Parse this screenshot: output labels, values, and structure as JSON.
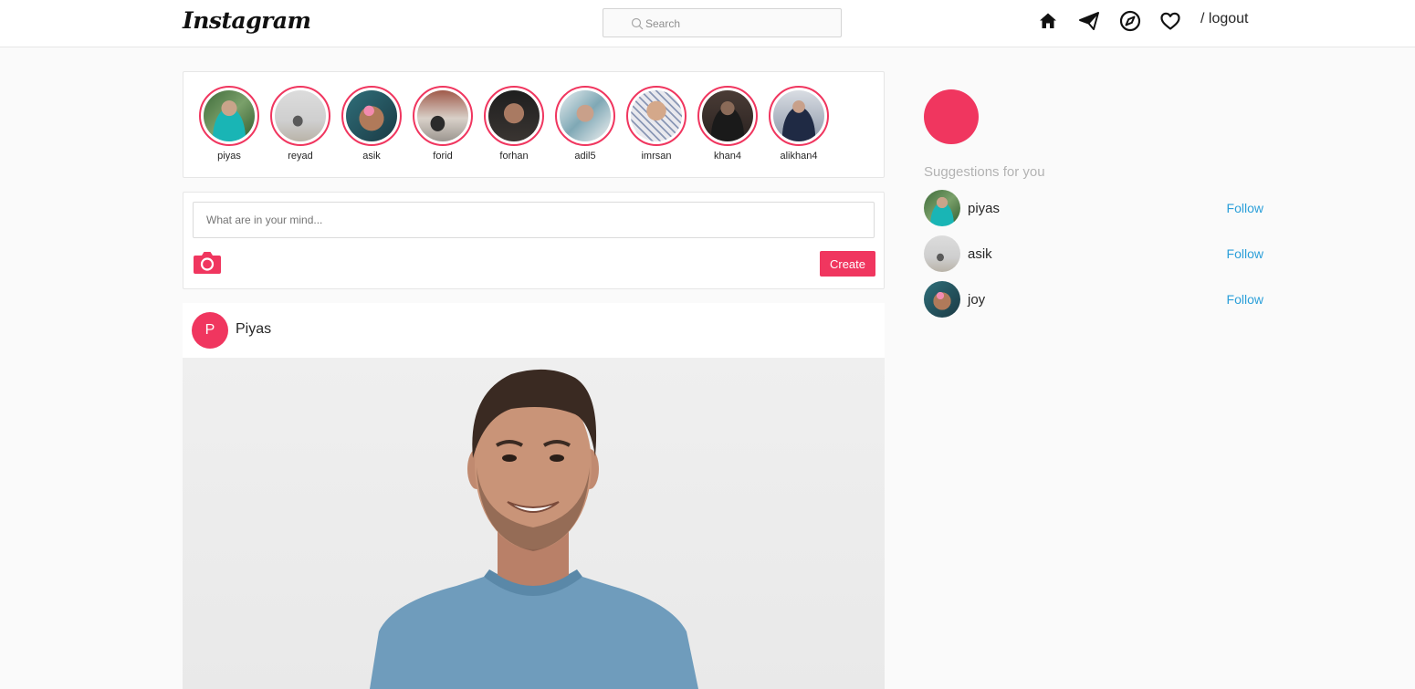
{
  "header": {
    "logo": "Instagram",
    "search_placeholder": "Search",
    "logout_label": "/ logout",
    "icons": [
      "home-icon",
      "paper-plane-icon",
      "compass-icon",
      "heart-icon"
    ]
  },
  "stories": [
    {
      "name": "piyas",
      "avatar": "avatar-piyas"
    },
    {
      "name": "reyad",
      "avatar": "avatar-reyad"
    },
    {
      "name": "asik",
      "avatar": "avatar-asik"
    },
    {
      "name": "forid",
      "avatar": "avatar-forid"
    },
    {
      "name": "forhan",
      "avatar": "avatar-forhan"
    },
    {
      "name": "adil5",
      "avatar": "avatar-adil5"
    },
    {
      "name": "imrsan",
      "avatar": "avatar-imrsan"
    },
    {
      "name": "khan4",
      "avatar": "avatar-khan4"
    },
    {
      "name": "alikhan4",
      "avatar": "avatar-alikhan4"
    }
  ],
  "composer": {
    "placeholder": "What are in your mind...",
    "create_label": "Create",
    "camera_icon": "camera-icon"
  },
  "post": {
    "avatar_letter": "P",
    "username": "Piyas"
  },
  "sidebar": {
    "suggestions_title": "Suggestions for you",
    "suggestions": [
      {
        "username": "piyas",
        "action": "Follow"
      },
      {
        "username": "asik",
        "action": "Follow"
      },
      {
        "username": "joy",
        "action": "Follow"
      }
    ]
  },
  "colors": {
    "accent": "#f0365f",
    "link": "#2b9fd9",
    "background": "#fafafa"
  }
}
